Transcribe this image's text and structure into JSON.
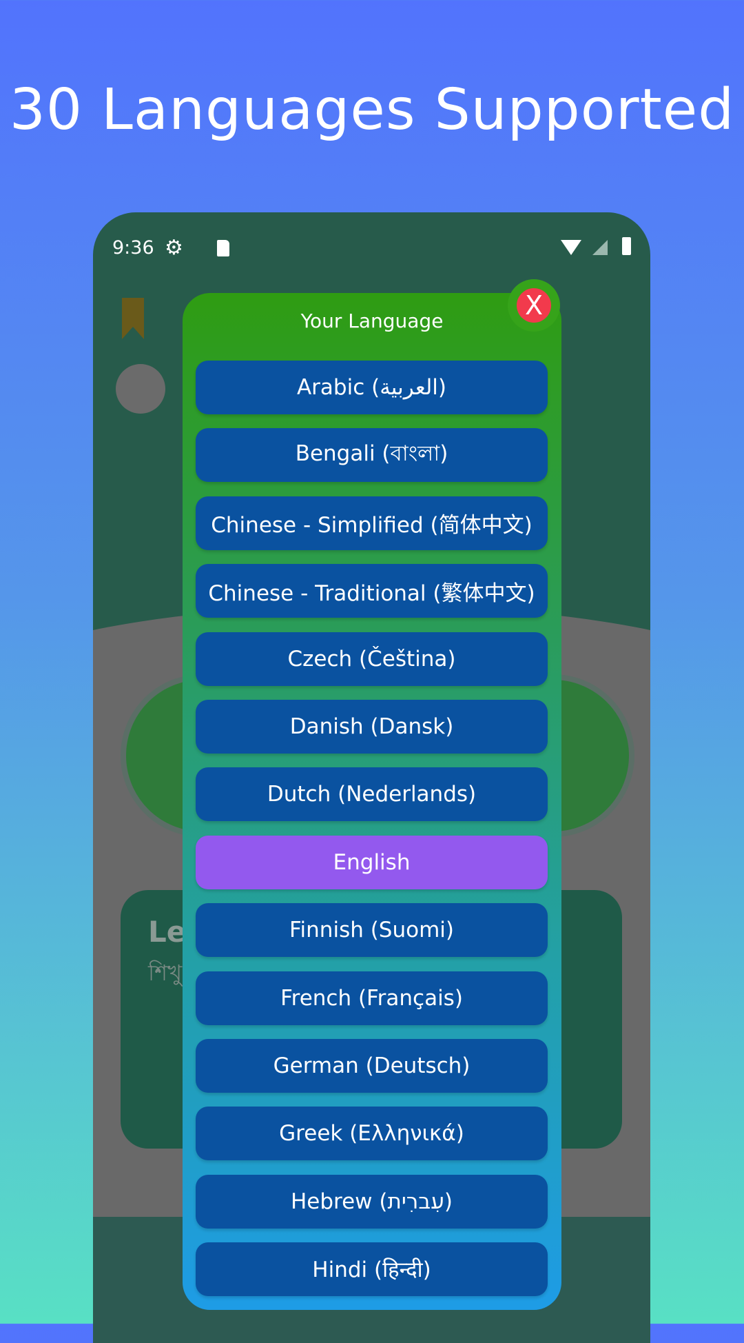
{
  "headline": "30 Languages Supported",
  "status_bar": {
    "time": "9:36",
    "icons": [
      "gear-icon",
      "sd-card-icon",
      "wifi-icon",
      "signal-icon",
      "battery-icon"
    ]
  },
  "background_app": {
    "card_title_partial": "Lea",
    "card_subtitle_partial": "শিখু"
  },
  "dialog": {
    "title": "Your Language",
    "close_label": "X",
    "selected": "English",
    "languages": [
      "Arabic (العربية)",
      "Bengali (বাংলা)",
      "Chinese - Simplified (简体中文)",
      "Chinese - Traditional (繁体中文)",
      "Czech (Čeština)",
      "Danish (Dansk)",
      "Dutch (Nederlands)",
      "English",
      "Finnish (Suomi)",
      "French (Français)",
      "German (Deutsch)",
      "Greek (Ελληνικά)",
      "Hebrew (עִברִית)",
      "Hindi (हिन्दी)"
    ]
  },
  "colors": {
    "button": "#0a52a0",
    "selected_button": "#9359ee",
    "close": "#f23a4c",
    "dialog_top": "#2f9c12",
    "dialog_bottom": "#1e9ce6"
  }
}
